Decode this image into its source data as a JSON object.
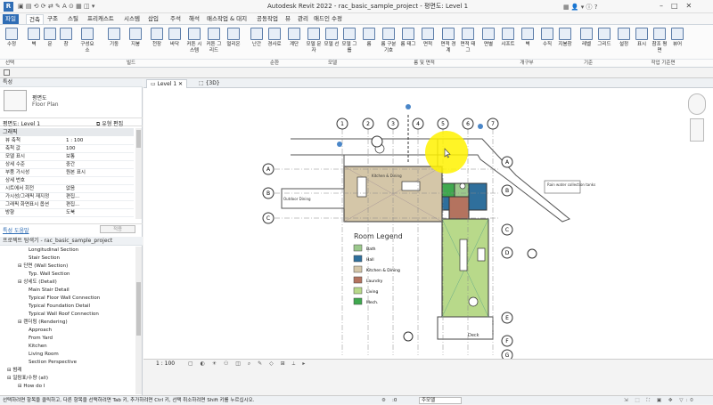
{
  "window": {
    "title": "Autodesk Revit 2022 - rac_basic_sample_project - 평면도: Level 1"
  },
  "ribbon": {
    "tabs": [
      "파일",
      "건축",
      "구조",
      "스틸",
      "프리캐스트",
      "시스템",
      "삽입",
      "주석",
      "해석",
      "매스작업 & 대지",
      "공동작업",
      "뷰",
      "관리",
      "애드인",
      "수정"
    ],
    "buttons": [
      "수정",
      "벽",
      "문",
      "창",
      "구성요소",
      "기둥",
      "지붕",
      "천장",
      "바닥",
      "커튼 시스템",
      "커튼 그리드",
      "멀리온",
      "난간",
      "경사로",
      "계단",
      "모델 문자",
      "모델 선",
      "모델 그룹",
      "룸",
      "룸 구분 기호",
      "룸 태그",
      "면적",
      "면적 경계",
      "면적 태그",
      "면별",
      "샤프트",
      "벽",
      "수직",
      "지붕창",
      "레벨",
      "그리드",
      "설정",
      "표시",
      "참조 평면",
      "뷰어"
    ],
    "groups": [
      "선택",
      "빌드",
      "순환",
      "모델",
      "룸 및 면적",
      "개구부",
      "기준",
      "작업 기준면"
    ]
  },
  "properties": {
    "header": "특성",
    "type_name": "평면도",
    "type_sub": "Floor Plan",
    "selector": "평면도: Level 1",
    "edit_type": "유형 편집",
    "section": "그래픽",
    "rows": [
      {
        "k": "뷰 축척",
        "v": "1 : 100"
      },
      {
        "k": "축척 값",
        "v": "100"
      },
      {
        "k": "모델 표시",
        "v": "보통"
      },
      {
        "k": "상세 수준",
        "v": "중간"
      },
      {
        "k": "부품 가시성",
        "v": "원본 표시"
      },
      {
        "k": "상세 번호",
        "v": ""
      },
      {
        "k": "시트에서 회전",
        "v": "없음"
      },
      {
        "k": "가시성/그래픽 재지정",
        "v": "편집..."
      },
      {
        "k": "그래픽 화면표시 옵션",
        "v": "편집..."
      },
      {
        "k": "방향",
        "v": "도북"
      }
    ],
    "help_link": "특성 도움말",
    "apply": "적용"
  },
  "browser": {
    "header": "프로젝트 탐색기 - rac_basic_sample_project",
    "items": [
      {
        "t": "Longitudinal Section",
        "d": 2
      },
      {
        "t": "Stair Section",
        "d": 2
      },
      {
        "t": "단면 (Wall Section)",
        "d": 1
      },
      {
        "t": "Typ. Wall Section",
        "d": 2
      },
      {
        "t": "상세도 (Detail)",
        "d": 1
      },
      {
        "t": "Main Stair Detail",
        "d": 2
      },
      {
        "t": "Typical Floor Wall Connection",
        "d": 2
      },
      {
        "t": "Typical Foundation Detail",
        "d": 2
      },
      {
        "t": "Typical Wall Roof Connection",
        "d": 2
      },
      {
        "t": "렌더링 (Rendering)",
        "d": 1
      },
      {
        "t": "Approach",
        "d": 2
      },
      {
        "t": "From Yard",
        "d": 2
      },
      {
        "t": "Kitchen",
        "d": 2
      },
      {
        "t": "Living Room",
        "d": 2
      },
      {
        "t": "Section Perspective",
        "d": 2
      },
      {
        "t": "범례",
        "d": 0
      },
      {
        "t": "일람표/수량 (all)",
        "d": 0
      },
      {
        "t": "How do I",
        "d": 1
      }
    ]
  },
  "views": {
    "tabs": [
      "Level 1",
      "{3D}"
    ]
  },
  "plan": {
    "grid_numbers": [
      "1",
      "2",
      "3",
      "4",
      "5",
      "6",
      "7"
    ],
    "grid_letters_left": [
      "A",
      "B",
      "C"
    ],
    "grid_letters_right": [
      "A",
      "B",
      "C",
      "D",
      "E",
      "F",
      "G"
    ],
    "labels": {
      "outdoor_dining": "Outdoor Dining",
      "kitchen": "Kitchen & Dining",
      "rain": "Rain water collection tanks",
      "deck": "Deck"
    },
    "legend_title": "Room Legend",
    "legend": [
      {
        "name": "Bath",
        "color": "#9bc88c"
      },
      {
        "name": "Hall",
        "color": "#2f6f9c"
      },
      {
        "name": "Kitchen & Dining",
        "color": "#d4c6a8"
      },
      {
        "name": "Laundry",
        "color": "#b4735f"
      },
      {
        "name": "Living",
        "color": "#b8d98a"
      },
      {
        "name": "Mech.",
        "color": "#3fa84e"
      }
    ]
  },
  "viewbar": {
    "scale": "1 : 100"
  },
  "status": {
    "hint": "선택하려면 항목을 클릭하고, 다른 항목을 선택하려면 Tab 키, 추가하려면 Ctrl 키, 선택 취소하려면 Shift 키를 누르십시오.",
    "value": ":0",
    "model": "주모델"
  }
}
